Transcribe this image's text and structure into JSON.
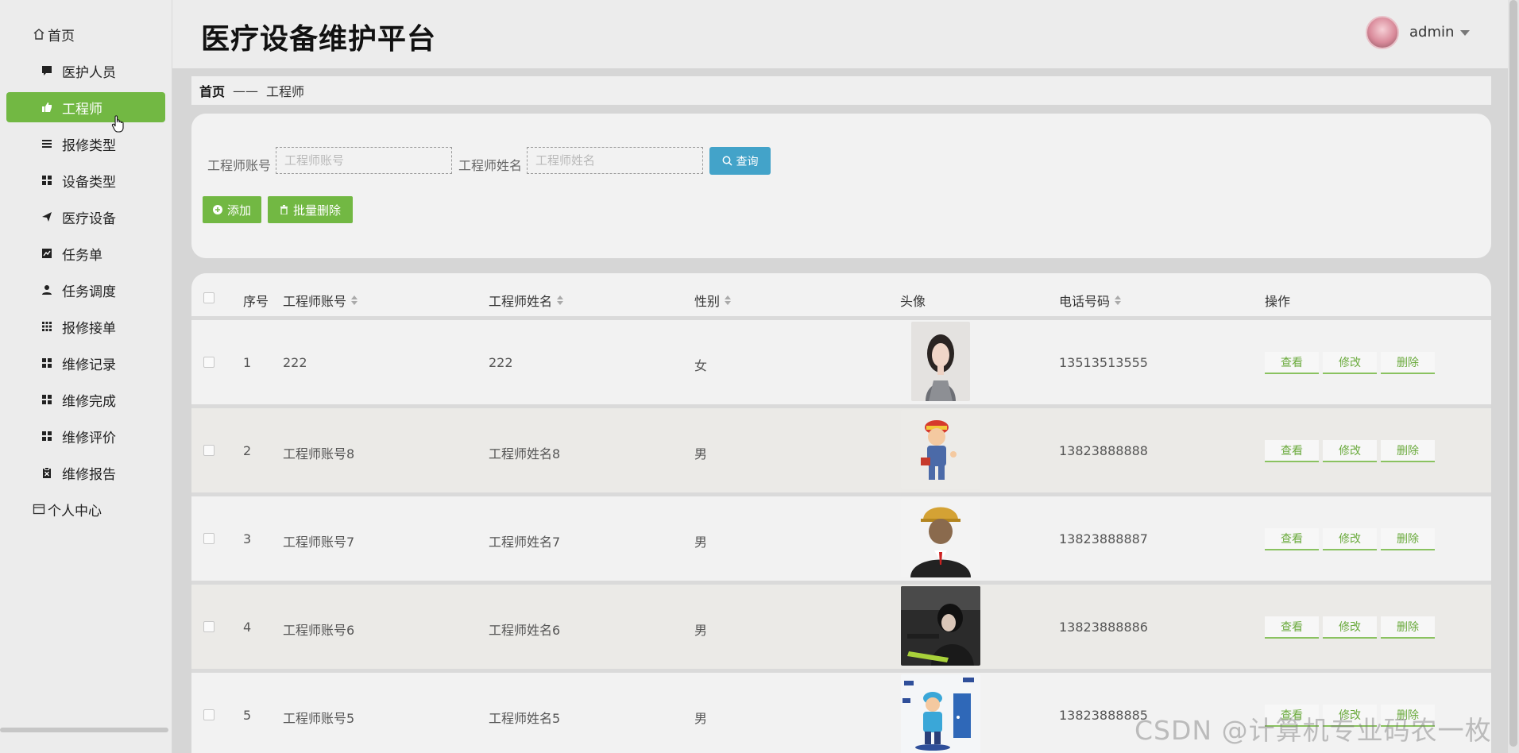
{
  "app": {
    "title": "医疗设备维护平台",
    "user": "admin"
  },
  "sidebar": {
    "items": [
      {
        "label": "首页",
        "icon": "home-icon"
      },
      {
        "label": "医护人员",
        "icon": "chat-icon"
      },
      {
        "label": "工程师",
        "icon": "thumbs-up-icon"
      },
      {
        "label": "报修类型",
        "icon": "list-icon"
      },
      {
        "label": "设备类型",
        "icon": "grid-icon"
      },
      {
        "label": "医疗设备",
        "icon": "paper-plane-icon"
      },
      {
        "label": "任务单",
        "icon": "chart-icon"
      },
      {
        "label": "任务调度",
        "icon": "user-icon"
      },
      {
        "label": "报修接单",
        "icon": "apps-icon"
      },
      {
        "label": "维修记录",
        "icon": "grid-icon"
      },
      {
        "label": "维修完成",
        "icon": "grid-icon"
      },
      {
        "label": "维修评价",
        "icon": "grid-icon"
      },
      {
        "label": "维修报告",
        "icon": "clipboard-icon"
      },
      {
        "label": "个人中心",
        "icon": "card-icon"
      }
    ],
    "active": "工程师"
  },
  "breadcrumb": {
    "home": "首页",
    "sep": "——",
    "current": "工程师"
  },
  "search": {
    "account_label": "工程师账号",
    "account_placeholder": "工程师账号",
    "name_label": "工程师姓名",
    "name_placeholder": "工程师姓名",
    "query_label": "查询"
  },
  "toolbar": {
    "add_label": "添加",
    "batch_delete_label": "批量删除"
  },
  "table": {
    "headers": {
      "index": "序号",
      "account": "工程师账号",
      "name": "工程师姓名",
      "gender": "性别",
      "avatar": "头像",
      "phone": "电话号码",
      "actions": "操作"
    },
    "action_labels": {
      "view": "查看",
      "edit": "修改",
      "delete": "删除"
    },
    "rows": [
      {
        "index": "1",
        "account": "222",
        "name": "222",
        "gender": "女",
        "phone": "13513513555"
      },
      {
        "index": "2",
        "account": "工程师账号8",
        "name": "工程师姓名8",
        "gender": "男",
        "phone": "13823888888"
      },
      {
        "index": "3",
        "account": "工程师账号7",
        "name": "工程师姓名7",
        "gender": "男",
        "phone": "13823888887"
      },
      {
        "index": "4",
        "account": "工程师账号6",
        "name": "工程师姓名6",
        "gender": "男",
        "phone": "13823888886"
      },
      {
        "index": "5",
        "account": "工程师账号5",
        "name": "工程师姓名5",
        "gender": "男",
        "phone": "13823888885"
      }
    ]
  },
  "watermark": "CSDN @计算机专业码农一枚",
  "colors": {
    "accent_green": "#72b843",
    "query_blue": "#43a3c9"
  }
}
